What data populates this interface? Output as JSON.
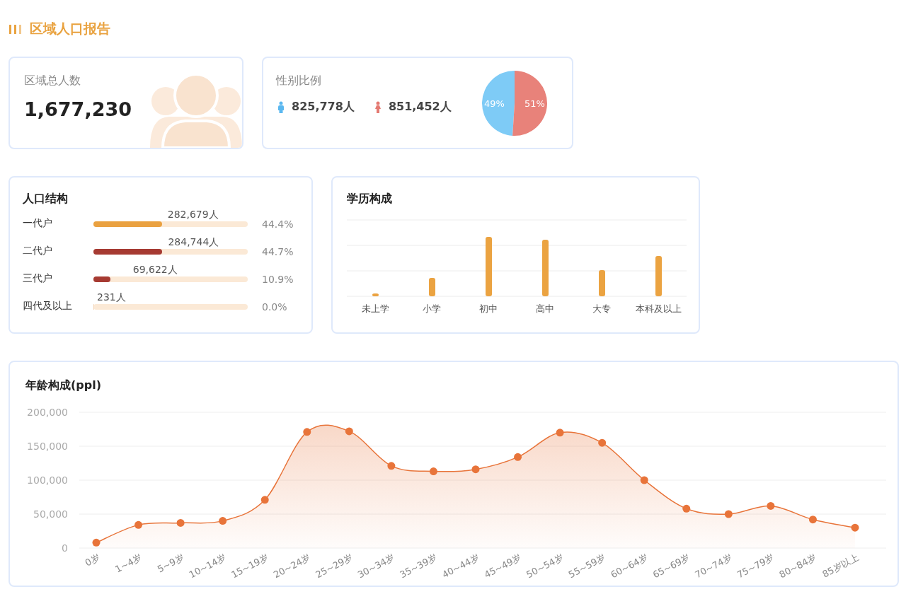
{
  "title": "区域人口报告",
  "total": {
    "label": "区域总人数",
    "value": "1,677,230"
  },
  "gender": {
    "label": "性别比例",
    "groups": [
      {
        "kind": "male",
        "count": "825,778人",
        "color": "#5bb8f0"
      },
      {
        "kind": "female",
        "count": "851,452人",
        "color": "#e47a72"
      }
    ],
    "chart_data": {
      "type": "pie",
      "values": [
        49,
        51
      ],
      "value_labels": [
        "49%",
        "51%"
      ],
      "colors": [
        "#7ecbf6",
        "#e8827a"
      ]
    }
  },
  "structure": {
    "title": "人口结构",
    "rows": [
      {
        "label": "一代户",
        "count": "282,679人",
        "percent": "44.4%",
        "level": 0.444,
        "color": "#eaa140"
      },
      {
        "label": "二代户",
        "count": "284,744人",
        "percent": "44.7%",
        "level": 0.447,
        "color": "#a63a32"
      },
      {
        "label": "三代户",
        "count": "69,622人",
        "percent": "10.9%",
        "level": 0.109,
        "color": "#a63a32"
      },
      {
        "label": "四代及以上",
        "count": "231人",
        "percent": "0.0%",
        "level": 0.0
      }
    ]
  },
  "education": {
    "title": "学历构成",
    "categories": [
      "未上学",
      "小学",
      "初中",
      "高中",
      "大专",
      "本科及以上"
    ]
  },
  "age": {
    "title": "年龄构成(ppl)",
    "chart_data": {
      "type": "area",
      "categories": [
        "0岁",
        "1~4岁",
        "5~9岁",
        "10~14岁",
        "15~19岁",
        "20~24岁",
        "25~29岁",
        "30~34岁",
        "35~39岁",
        "40~44岁",
        "45~49岁",
        "50~54岁",
        "55~59岁",
        "60~64岁",
        "65~69岁",
        "70~74岁",
        "75~79岁",
        "80~84岁",
        "85岁以上"
      ],
      "color": "#e8743a",
      "values": [
        8000,
        34000,
        37000,
        40000,
        71000,
        171000,
        172000,
        121000,
        113000,
        116000,
        134000,
        170000,
        155000,
        100000,
        58000,
        50000,
        62000,
        42000,
        30000
      ],
      "ylim": [
        0,
        200000
      ],
      "grid": true,
      "yticks": [
        {
          "value": 0,
          "label": "0"
        },
        {
          "value": 50000,
          "label": "50,000"
        },
        {
          "value": 100000,
          "label": "100,000"
        },
        {
          "value": 150000,
          "label": "150,000"
        },
        {
          "value": 200000,
          "label": "200,000"
        }
      ]
    }
  }
}
